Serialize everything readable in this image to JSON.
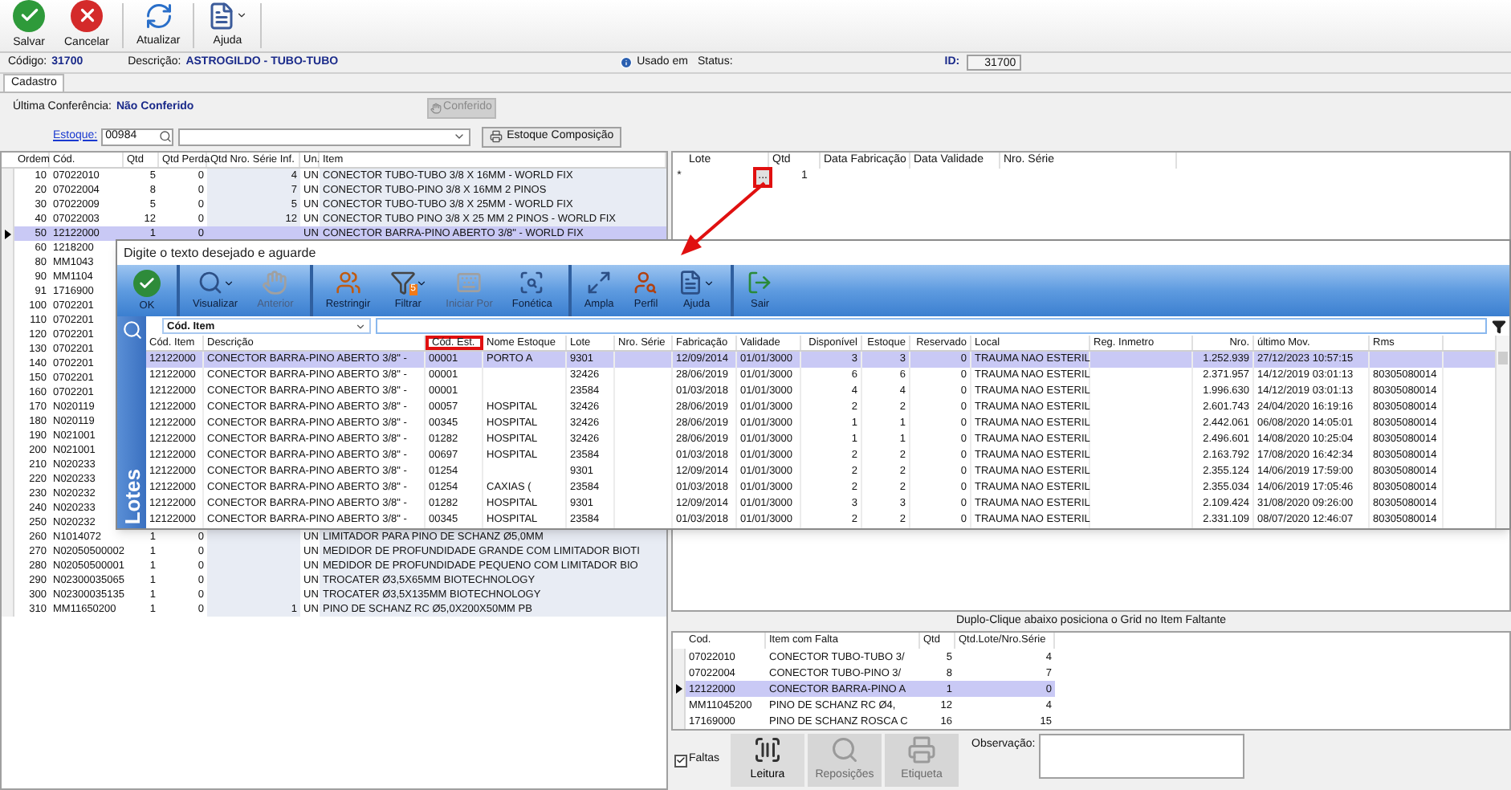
{
  "toolbar": {
    "buttons": [
      {
        "kind": "save",
        "label": "Salvar",
        "has_menu": false
      },
      {
        "kind": "cancel",
        "label": "Cancelar",
        "has_menu": false
      },
      {
        "kind": "refresh",
        "label": "Atualizar",
        "has_menu": false
      },
      {
        "kind": "help",
        "label": "Ajuda",
        "has_menu": true
      }
    ]
  },
  "header": {
    "codigo_label": "Código:",
    "codigo": "31700",
    "descricao_label": "Descrição:",
    "descricao": "ASTROGILDO - TUBO-TUBO",
    "usado_em": "Usado em",
    "status_label": "Status:",
    "id_label": "ID:",
    "id": "31700"
  },
  "tabs": [
    {
      "label": "Cadastro",
      "selected": true
    }
  ],
  "form": {
    "conferencia_label": "Última Conferência:",
    "conferencia": "Não Conferido",
    "conferido_button": {
      "label": "Conferido",
      "disabled": true
    },
    "estoque_label": "Estoque:",
    "estoque_code": "00984",
    "composicao_button": "Estoque Composição"
  },
  "items_table": {
    "columns": [
      "Ordem",
      "Cód.",
      "Qtd",
      "Qtd Perda",
      "Qtd Nro. Série Inf.",
      "Un.",
      "Item"
    ],
    "rows": [
      {
        "covered": false,
        "selected": false,
        "ordem": "10",
        "cod": "07022010",
        "qtd": "5",
        "perda": "0",
        "serie_inf": "4",
        "un": "UN",
        "item": "CONECTOR TUBO-TUBO 3/8 X 16MM - WORLD FIX"
      },
      {
        "covered": false,
        "selected": false,
        "ordem": "20",
        "cod": "07022004",
        "qtd": "8",
        "perda": "0",
        "serie_inf": "7",
        "un": "UN",
        "item": "CONECTOR TUBO-PINO 3/8 X 16MM 2 PINOS"
      },
      {
        "covered": false,
        "selected": false,
        "ordem": "30",
        "cod": "07022009",
        "qtd": "5",
        "perda": "0",
        "serie_inf": "5",
        "un": "UN",
        "item": "CONECTOR TUBO-TUBO 3/8 X 25MM - WORLD FIX"
      },
      {
        "covered": false,
        "selected": false,
        "ordem": "40",
        "cod": "07022003",
        "qtd": "12",
        "perda": "0",
        "serie_inf": "12",
        "un": "UN",
        "item": "CONECTOR TUBO PINO 3/8  X 25 MM 2 PINOS - WORLD FIX"
      },
      {
        "covered": false,
        "selected": true,
        "ordem": "50",
        "cod": "12122000",
        "qtd": "1",
        "perda": "0",
        "un": "UN",
        "item": "CONECTOR BARRA-PINO ABERTO 3/8\" -  WORLD FIX"
      },
      {
        "covered": true,
        "selected": false,
        "ordem": "60",
        "cod": "1218200"
      },
      {
        "covered": true,
        "selected": false,
        "ordem": "80",
        "cod": "MM1043"
      },
      {
        "covered": true,
        "selected": false,
        "ordem": "90",
        "cod": "MM1104"
      },
      {
        "covered": true,
        "selected": false,
        "ordem": "91",
        "cod": "1716900"
      },
      {
        "covered": true,
        "selected": false,
        "ordem": "100",
        "cod": "0702201"
      },
      {
        "covered": true,
        "selected": false,
        "ordem": "110",
        "cod": "0702201"
      },
      {
        "covered": true,
        "selected": false,
        "ordem": "120",
        "cod": "0702201"
      },
      {
        "covered": true,
        "selected": false,
        "ordem": "130",
        "cod": "0702201"
      },
      {
        "covered": true,
        "selected": false,
        "ordem": "140",
        "cod": "0702201"
      },
      {
        "covered": true,
        "selected": false,
        "ordem": "150",
        "cod": "0702201"
      },
      {
        "covered": true,
        "selected": false,
        "ordem": "160",
        "cod": "0702201"
      },
      {
        "covered": true,
        "selected": false,
        "ordem": "170",
        "cod": "N020119"
      },
      {
        "covered": true,
        "selected": false,
        "ordem": "180",
        "cod": "N020119"
      },
      {
        "covered": true,
        "selected": false,
        "ordem": "190",
        "cod": "N021001"
      },
      {
        "covered": true,
        "selected": false,
        "ordem": "200",
        "cod": "N021001"
      },
      {
        "covered": true,
        "selected": false,
        "ordem": "210",
        "cod": "N020233"
      },
      {
        "covered": true,
        "selected": false,
        "ordem": "220",
        "cod": "N020233"
      },
      {
        "covered": true,
        "selected": false,
        "ordem": "230",
        "cod": "N020232"
      },
      {
        "covered": true,
        "selected": false,
        "ordem": "240",
        "cod": "N020233"
      },
      {
        "covered": true,
        "selected": false,
        "ordem": "250",
        "cod": "N020232"
      },
      {
        "covered": false,
        "selected": false,
        "ordem": "260",
        "cod": "N1014072",
        "qtd": "1",
        "perda": "0",
        "un": "UN",
        "item": "LIMITADOR PARA PINO DE SCHANZ Ø5,0MM"
      },
      {
        "covered": false,
        "selected": false,
        "ordem": "270",
        "cod": "N02050500002",
        "qtd": "1",
        "perda": "0",
        "un": "UN",
        "item": "MEDIDOR DE PROFUNDIDADE GRANDE COM LIMITADOR BIOTI"
      },
      {
        "covered": false,
        "selected": false,
        "ordem": "280",
        "cod": "N02050500001",
        "qtd": "1",
        "perda": "0",
        "un": "UN",
        "item": "MEDIDOR DE PROFUNDIDADE PEQUENO COM LIMITADOR BIO"
      },
      {
        "covered": false,
        "selected": false,
        "ordem": "290",
        "cod": "N02300035065",
        "qtd": "1",
        "perda": "0",
        "un": "UN",
        "item": "TROCATER Ø3,5X65MM BIOTECHNOLOGY"
      },
      {
        "covered": false,
        "selected": false,
        "ordem": "300",
        "cod": "N02300035135",
        "qtd": "1",
        "perda": "0",
        "un": "UN",
        "item": "TROCATER Ø3,5X135MM BIOTECHNOLOGY"
      },
      {
        "covered": false,
        "selected": false,
        "ordem": "310",
        "cod": "MM11650200",
        "qtd": "1",
        "perda": "0",
        "serie_inf": "1",
        "un": "UN",
        "item": "PINO DE SCHANZ RC Ø5,0X200X50MM PB"
      }
    ]
  },
  "lotes_table": {
    "columns": [
      "Lote",
      "Qtd",
      "Data Fabricação",
      "Data Validade",
      "Nro. Série"
    ],
    "rows": [
      {
        "marker": "*",
        "button": "...",
        "button_highlighted": true,
        "qtd": "1"
      }
    ]
  },
  "faltas_hint": "Duplo-Clique abaixo posiciona o Grid no Item Faltante",
  "faltas_table": {
    "columns": [
      "Cod.",
      "Item com Falta",
      "Qtd",
      "Qtd.Lote/Nro.Série"
    ],
    "rows": [
      {
        "selected": false,
        "cod": "07022010",
        "item": "CONECTOR TUBO-TUBO 3/",
        "qtd": "5",
        "qtd_lote": "4"
      },
      {
        "selected": false,
        "cod": "07022004",
        "item": "CONECTOR TUBO-PINO 3/",
        "qtd": "8",
        "qtd_lote": "7"
      },
      {
        "selected": true,
        "cod": "12122000",
        "item": "CONECTOR BARRA-PINO A",
        "qtd": "1",
        "qtd_lote": "0"
      },
      {
        "selected": false,
        "cod": "MM11045200",
        "item": "PINO DE SCHANZ RC Ø4,",
        "qtd": "12",
        "qtd_lote": "4"
      },
      {
        "selected": false,
        "cod": "17169000",
        "item": "PINO DE SCHANZ ROSCA C",
        "qtd": "16",
        "qtd_lote": "15"
      }
    ]
  },
  "bottom": {
    "faltas_checkbox": {
      "label": "Faltas",
      "checked": true
    },
    "buttons": [
      {
        "kind": "barcode",
        "label": "Leitura",
        "disabled": false
      },
      {
        "kind": "search",
        "label": "Reposições",
        "disabled": true
      },
      {
        "kind": "printer",
        "label": "Etiqueta",
        "disabled": true
      }
    ],
    "observacao_label": "Observação:"
  },
  "popup": {
    "title": "Digite o texto desejado e aguarde",
    "toolbar": [
      {
        "kind": "ok",
        "label": "OK",
        "disabled": false,
        "has_menu": false,
        "separator_before": false
      },
      {
        "kind": "view",
        "label": "Visualizar",
        "disabled": false,
        "has_menu": true,
        "separator_before": true
      },
      {
        "kind": "previous",
        "label": "Anterior",
        "disabled": true,
        "has_menu": false,
        "separator_before": false
      },
      {
        "kind": "restrict",
        "label": "Restringir",
        "disabled": false,
        "has_menu": false,
        "separator_before": true
      },
      {
        "kind": "filter",
        "label": "Filtrar",
        "disabled": false,
        "has_menu": true,
        "separator_before": false,
        "badge": "5"
      },
      {
        "kind": "start",
        "label": "Iniciar Por",
        "disabled": true,
        "has_menu": false,
        "separator_before": false
      },
      {
        "kind": "phonetic",
        "label": "Fonética",
        "disabled": false,
        "has_menu": false,
        "separator_before": false
      },
      {
        "kind": "expand",
        "label": "Ampla",
        "disabled": false,
        "has_menu": false,
        "separator_before": true
      },
      {
        "kind": "profile",
        "label": "Perfil",
        "disabled": false,
        "has_menu": false,
        "separator_before": false
      },
      {
        "kind": "help",
        "label": "Ajuda",
        "disabled": false,
        "has_menu": true,
        "separator_before": false
      },
      {
        "kind": "exit",
        "label": "Sair",
        "disabled": false,
        "has_menu": false,
        "separator_before": true
      }
    ],
    "search_field": "Cód. Item",
    "side_label": "Lotes",
    "columns": [
      {
        "label": "Cód. Item",
        "numeric": false,
        "highlighted": false
      },
      {
        "label": "Descrição",
        "numeric": false,
        "highlighted": false
      },
      {
        "label": "Cód. Est.",
        "numeric": false,
        "highlighted": true
      },
      {
        "label": "Nome Estoque",
        "numeric": false,
        "highlighted": false
      },
      {
        "label": "Lote",
        "numeric": false,
        "highlighted": false
      },
      {
        "label": "Nro. Série",
        "numeric": false,
        "highlighted": false
      },
      {
        "label": "Fabricação",
        "numeric": false,
        "highlighted": false
      },
      {
        "label": "Validade",
        "numeric": false,
        "highlighted": false
      },
      {
        "label": "Disponível",
        "numeric": true,
        "highlighted": false
      },
      {
        "label": "Estoque",
        "numeric": true,
        "highlighted": false
      },
      {
        "label": "Reservado",
        "numeric": true,
        "highlighted": false
      },
      {
        "label": "Local",
        "numeric": false,
        "highlighted": false
      },
      {
        "label": "Reg. Inmetro",
        "numeric": false,
        "highlighted": false
      },
      {
        "label": "Nro.",
        "numeric": true,
        "highlighted": false
      },
      {
        "label": "último Mov.",
        "numeric": false,
        "highlighted": false
      },
      {
        "label": "Rms",
        "numeric": false,
        "highlighted": false
      }
    ],
    "rows": [
      {
        "selected": true,
        "cells": [
          "12122000",
          "CONECTOR BARRA-PINO ABERTO 3/8\" -",
          "00001",
          "PORTO A",
          "9301",
          null,
          "12/09/2014",
          "01/01/3000",
          "3",
          "3",
          "0",
          "TRAUMA NAO ESTERIL",
          null,
          "1.252.939",
          "27/12/2023 10:57:15",
          null
        ]
      },
      {
        "selected": false,
        "cells": [
          "12122000",
          "CONECTOR BARRA-PINO ABERTO 3/8\" -",
          "00001",
          null,
          "32426",
          null,
          "28/06/2019",
          "01/01/3000",
          "6",
          "6",
          "0",
          "TRAUMA NAO ESTERIL",
          null,
          "2.371.957",
          "14/12/2019 03:01:13",
          "80305080014"
        ]
      },
      {
        "selected": false,
        "cells": [
          "12122000",
          "CONECTOR BARRA-PINO ABERTO 3/8\" -",
          "00001",
          null,
          "23584",
          null,
          "01/03/2018",
          "01/01/3000",
          "4",
          "4",
          "0",
          "TRAUMA NAO ESTERIL",
          null,
          "1.996.630",
          "14/12/2019 03:01:13",
          "80305080014"
        ]
      },
      {
        "selected": false,
        "cells": [
          "12122000",
          "CONECTOR BARRA-PINO ABERTO 3/8\" -",
          "00057",
          "HOSPITAL",
          "32426",
          null,
          "28/06/2019",
          "01/01/3000",
          "2",
          "2",
          "0",
          "TRAUMA NAO ESTERIL",
          null,
          "2.601.743",
          "24/04/2020 16:19:16",
          "80305080014"
        ]
      },
      {
        "selected": false,
        "cells": [
          "12122000",
          "CONECTOR BARRA-PINO ABERTO 3/8\" -",
          "00345",
          "HOSPITAL",
          "32426",
          null,
          "28/06/2019",
          "01/01/3000",
          "1",
          "1",
          "0",
          "TRAUMA NAO ESTERIL",
          null,
          "2.442.061",
          "06/08/2020 14:05:01",
          "80305080014"
        ]
      },
      {
        "selected": false,
        "cells": [
          "12122000",
          "CONECTOR BARRA-PINO ABERTO 3/8\" -",
          "01282",
          "HOSPITAL",
          "32426",
          null,
          "28/06/2019",
          "01/01/3000",
          "1",
          "1",
          "0",
          "TRAUMA NAO ESTERIL",
          null,
          "2.496.601",
          "14/08/2020 10:25:04",
          "80305080014"
        ]
      },
      {
        "selected": false,
        "cells": [
          "12122000",
          "CONECTOR BARRA-PINO ABERTO 3/8\" -",
          "00697",
          "HOSPITAL",
          "23584",
          null,
          "01/03/2018",
          "01/01/3000",
          "2",
          "2",
          "0",
          "TRAUMA NAO ESTERIL",
          null,
          "2.163.792",
          "17/08/2020 16:42:34",
          "80305080014"
        ]
      },
      {
        "selected": false,
        "cells": [
          "12122000",
          "CONECTOR BARRA-PINO ABERTO 3/8\" -",
          "01254",
          null,
          "9301",
          null,
          "12/09/2014",
          "01/01/3000",
          "2",
          "2",
          "0",
          "TRAUMA NAO ESTERIL",
          null,
          "2.355.124",
          "14/06/2019 17:59:00",
          "80305080014"
        ]
      },
      {
        "selected": false,
        "cells": [
          "12122000",
          "CONECTOR BARRA-PINO ABERTO 3/8\" -",
          "01254",
          "CAXIAS (",
          "23584",
          null,
          "01/03/2018",
          "01/01/3000",
          "2",
          "2",
          "0",
          "TRAUMA NAO ESTERIL",
          null,
          "2.355.034",
          "14/06/2019 17:05:46",
          "80305080014"
        ]
      },
      {
        "selected": false,
        "cells": [
          "12122000",
          "CONECTOR BARRA-PINO ABERTO 3/8\" -",
          "01282",
          "HOSPITAL",
          "9301",
          null,
          "12/09/2014",
          "01/01/3000",
          "3",
          "3",
          "0",
          "TRAUMA NAO ESTERIL",
          null,
          "2.109.424",
          "31/08/2020 09:26:00",
          "80305080014"
        ]
      },
      {
        "selected": false,
        "cells": [
          "12122000",
          "CONECTOR BARRA-PINO ABERTO 3/8\" -",
          "00345",
          "HOSPITAL",
          "23584",
          null,
          "01/03/2018",
          "01/01/3000",
          "2",
          "2",
          "0",
          "TRAUMA NAO ESTERIL",
          null,
          "2.331.109",
          "08/07/2020 12:46:07",
          "80305080014"
        ]
      }
    ]
  }
}
